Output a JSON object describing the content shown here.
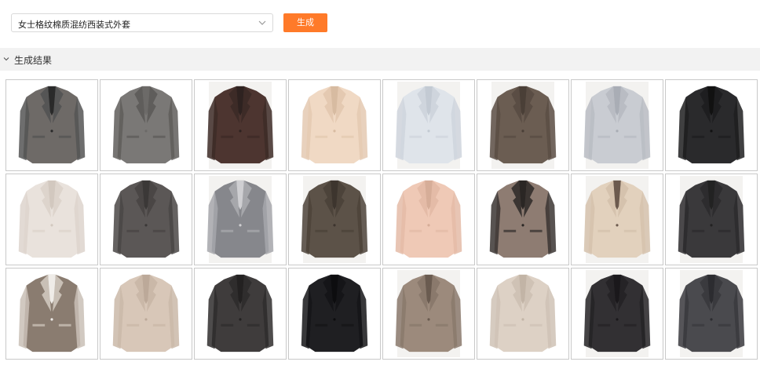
{
  "toolbar": {
    "select_value": "女士格纹棉质混纺西装式外套",
    "generate_label": "生成"
  },
  "results": {
    "title": "生成结果",
    "items": [
      {
        "icon": "blazer-image",
        "fabric": "#6e6a67",
        "lapel": "#555",
        "inner": "#2a2a2a",
        "bg": false
      },
      {
        "icon": "blazer-image",
        "fabric": "#7a7876",
        "lapel": "#5f5d5b",
        "inner": "#6c6a68",
        "bg": false
      },
      {
        "icon": "blazer-image",
        "fabric": "#4d3530",
        "lapel": "#3d2b27",
        "inner": "#2e2220",
        "bg": true
      },
      {
        "icon": "blazer-image",
        "fabric": "#f0d9c4",
        "lapel": "#e4c9b1",
        "inner": "#d7bba1",
        "bg": false
      },
      {
        "icon": "blazer-image",
        "fabric": "#dfe4ea",
        "lapel": "#cfd5dd",
        "inner": "#c3cad3",
        "bg": true
      },
      {
        "icon": "blazer-image",
        "fabric": "#6b5d52",
        "lapel": "#5a4d44",
        "inner": "#4a3f37",
        "bg": true
      },
      {
        "icon": "blazer-image",
        "fabric": "#c9ccd2",
        "lapel": "#b9bcc3",
        "inner": "#a9adb5",
        "bg": true
      },
      {
        "icon": "blazer-image",
        "fabric": "#2a2a2c",
        "lapel": "#1e1e20",
        "inner": "#111",
        "bg": false
      },
      {
        "icon": "blazer-image",
        "fabric": "#e9e2dc",
        "lapel": "#ddd4cc",
        "inner": "#d2c8bf",
        "bg": false
      },
      {
        "icon": "blazer-image",
        "fabric": "#5b5756",
        "lapel": "#4a4645",
        "inner": "#3b3837",
        "bg": false
      },
      {
        "icon": "blazer-image",
        "fabric": "#86878c",
        "lapel": "#a6a7ab",
        "inner": "#cfcfd2",
        "bg": true
      },
      {
        "icon": "blazer-image",
        "fabric": "#5c5248",
        "lapel": "#4c433a",
        "inner": "#3d352e",
        "bg": true
      },
      {
        "icon": "blazer-image",
        "fabric": "#efc9b6",
        "lapel": "#e4bba7",
        "inner": "#d6ad98",
        "bg": false
      },
      {
        "icon": "blazer-image",
        "fabric": "#8e7c72",
        "lapel": "#3b3532",
        "inner": "#2a2624",
        "bg": false
      },
      {
        "icon": "blazer-image",
        "fabric": "#e2d1bd",
        "lapel": "#d5c2ad",
        "inner": "#6c5a4e",
        "bg": true
      },
      {
        "icon": "blazer-image",
        "fabric": "#3a393b",
        "lapel": "#2d2c2e",
        "inner": "#222",
        "bg": true
      },
      {
        "icon": "blazer-image",
        "fabric": "#8a7c70",
        "lapel": "#c9c0b6",
        "inner": "#efece8",
        "bg": false
      },
      {
        "icon": "blazer-image",
        "fabric": "#d8c7b8",
        "lapel": "#cab8a8",
        "inner": "#bca999",
        "bg": false
      },
      {
        "icon": "blazer-image",
        "fabric": "#3f3c3c",
        "lapel": "#2f2d2d",
        "inner": "#232121",
        "bg": false
      },
      {
        "icon": "blazer-image",
        "fabric": "#1f1f22",
        "lapel": "#151518",
        "inner": "#0d0d0f",
        "bg": false
      },
      {
        "icon": "blazer-image",
        "fabric": "#9c8a7c",
        "lapel": "#8a796c",
        "inner": "#6a5b50",
        "bg": true
      },
      {
        "icon": "blazer-image",
        "fabric": "#ddd1c5",
        "lapel": "#cfc2b5",
        "inner": "#c2b4a6",
        "bg": false
      },
      {
        "icon": "blazer-image",
        "fabric": "#323033",
        "lapel": "#252326",
        "inner": "#1a181b",
        "bg": true
      },
      {
        "icon": "blazer-image",
        "fabric": "#4a4a4e",
        "lapel": "#3a3a3e",
        "inner": "#2c2c30",
        "bg": true
      }
    ]
  },
  "colors": {
    "accent": "#ff7a29",
    "header_bg": "#f2f2f2",
    "cell_border": "#c9c9c9"
  }
}
